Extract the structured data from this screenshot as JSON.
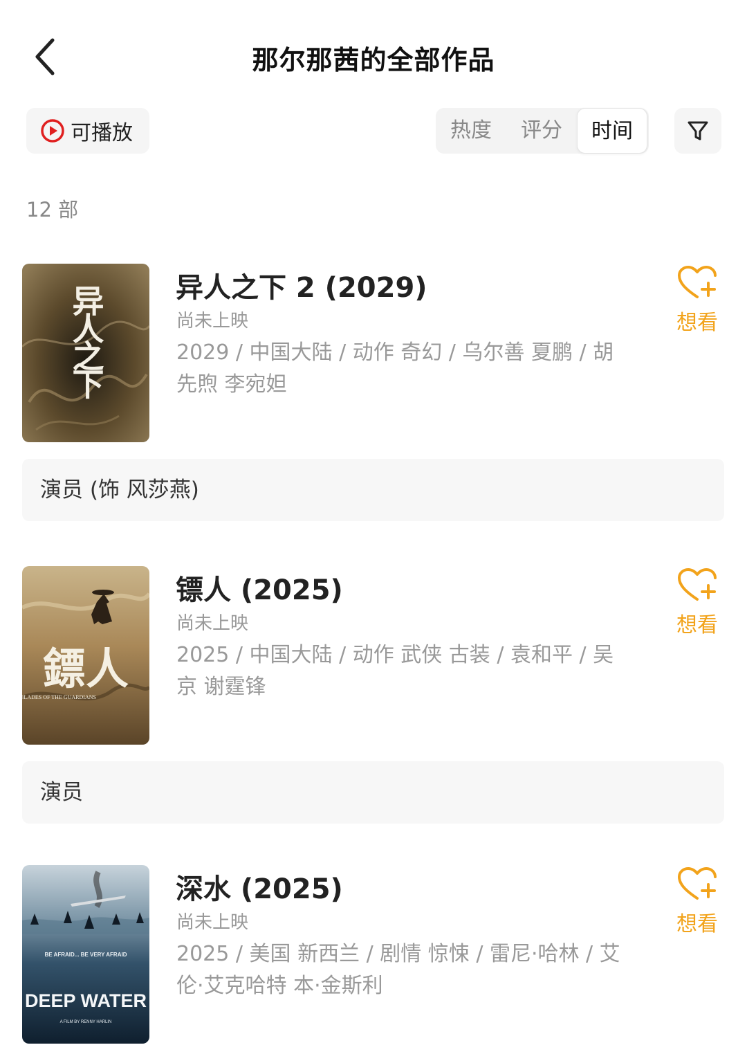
{
  "header": {
    "title": "那尔那茜的全部作品"
  },
  "toolbar": {
    "play_label": "可播放",
    "sort_tabs": [
      {
        "label": "热度",
        "active": false
      },
      {
        "label": "评分",
        "active": false
      },
      {
        "label": "时间",
        "active": true
      }
    ]
  },
  "count_label": "12 部",
  "movies": [
    {
      "title": "异人之下 2 (2029)",
      "status": "尚未上映",
      "meta": "2029 / 中国大陆 / 动作 奇幻 / 乌尔善 夏鹏 / 胡先煦 李宛妲",
      "want_label": "想看",
      "role": "演员 (饰 风莎燕)",
      "poster_text": "异人之下"
    },
    {
      "title": "镖人 (2025)",
      "status": "尚未上映",
      "meta": "2025 / 中国大陆 / 动作 武侠 古装 / 袁和平 / 吴京 谢霆锋",
      "want_label": "想看",
      "role": "演员",
      "poster_text": "鏢人",
      "poster_subtext": "BLADES OF THE GUARDIANS"
    },
    {
      "title": "深水 (2025)",
      "status": "尚未上映",
      "meta": "2025 / 美国 新西兰 / 剧情 惊悚 / 雷尼·哈林 / 艾伦·艾克哈特 本·金斯利",
      "want_label": "想看",
      "poster_text": "DEEP WATER",
      "poster_tagline": "BE AFRAID... BE VERY AFRAID",
      "poster_credit": "A FILM BY RENNY HARLIN"
    }
  ],
  "colors": {
    "accent": "#f2a31b",
    "play_red": "#e02020"
  }
}
